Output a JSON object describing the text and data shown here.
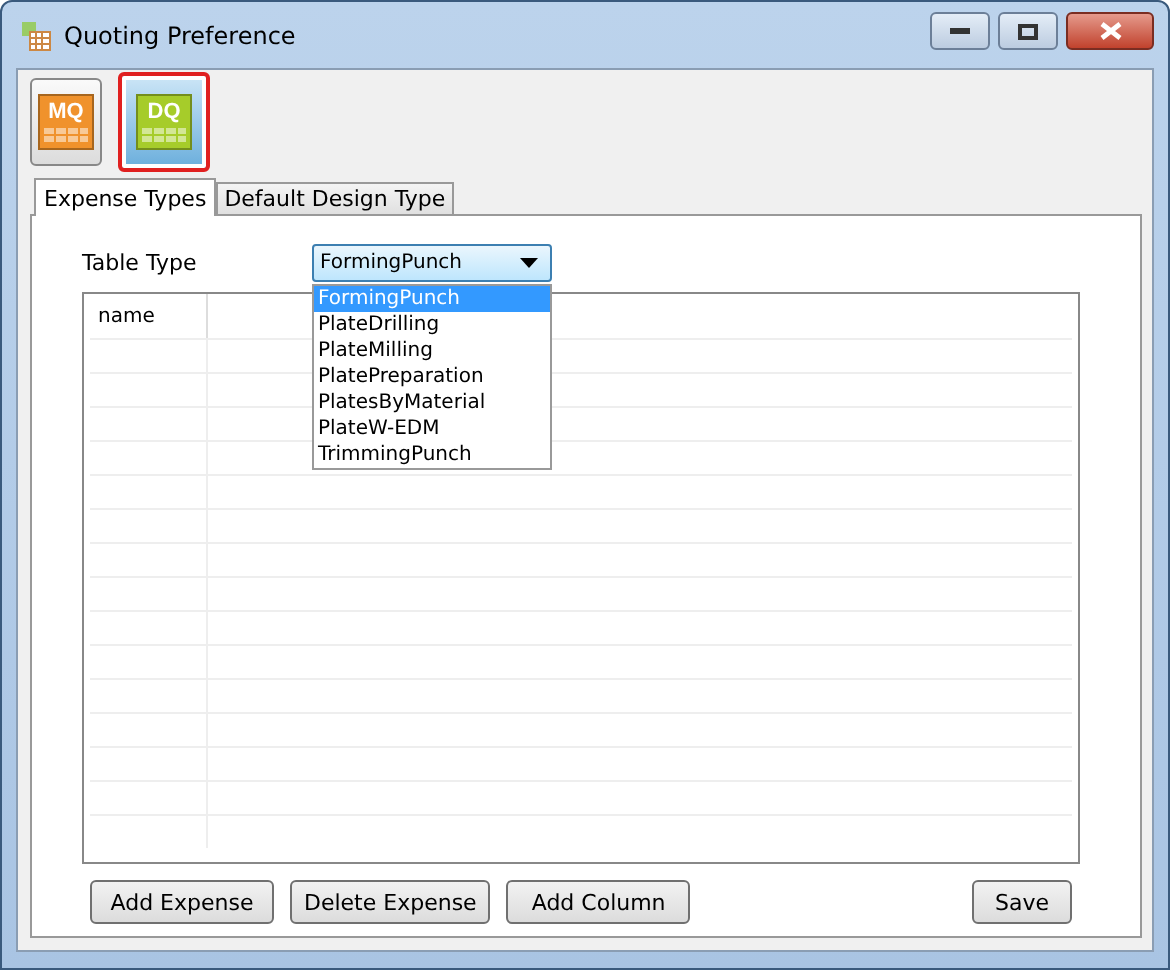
{
  "window": {
    "title": "Quoting Preference"
  },
  "toolbar": [
    {
      "label": "MQ",
      "color": "#f0922c",
      "selected": false
    },
    {
      "label": "DQ",
      "color": "#a6cc2a",
      "selected": true
    }
  ],
  "tabs": [
    {
      "label": "Expense Types",
      "selected": true
    },
    {
      "label": "Default Design Type",
      "selected": false
    }
  ],
  "table_type": {
    "label": "Table Type",
    "value": "FormingPunch",
    "expanded": true,
    "options": [
      {
        "label": "FormingPunch",
        "selected": true
      },
      {
        "label": "PlateDrilling",
        "selected": false
      },
      {
        "label": "PlateMilling",
        "selected": false
      },
      {
        "label": "PlatePreparation",
        "selected": false
      },
      {
        "label": "PlatesByMaterial",
        "selected": false
      },
      {
        "label": "PlateW-EDM",
        "selected": false
      },
      {
        "label": "TrimmingPunch",
        "selected": false
      }
    ]
  },
  "grid": {
    "columns": [
      "name"
    ]
  },
  "buttons": [
    {
      "label": "Add Expense",
      "kind": "left"
    },
    {
      "label": "Delete Expense",
      "kind": "left"
    },
    {
      "label": "Add Column",
      "kind": "left"
    },
    {
      "label": "Save",
      "kind": "right"
    }
  ]
}
